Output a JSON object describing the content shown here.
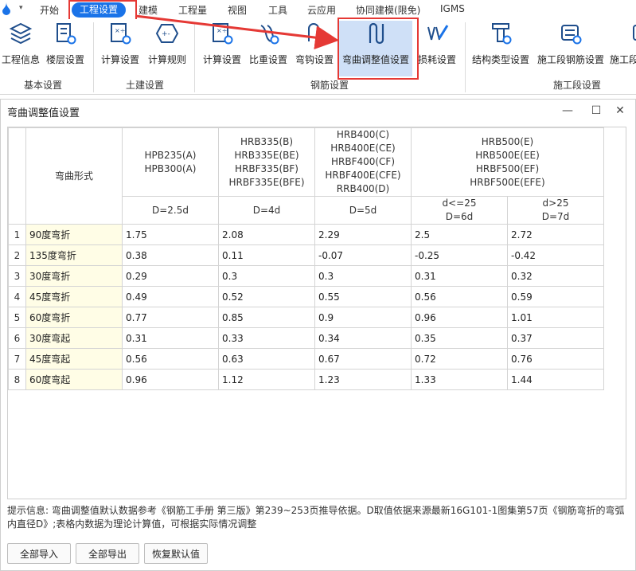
{
  "menubar": {
    "items": [
      "开始",
      "工程设置",
      "建模",
      "工程量",
      "视图",
      "工具",
      "云应用",
      "协同建模(限免)",
      "IGMS"
    ],
    "active_index": 1
  },
  "ribbon": {
    "groups": [
      {
        "label": "基本设置",
        "buttons": [
          {
            "label": "工程信息"
          },
          {
            "label": "楼层设置"
          }
        ]
      },
      {
        "label": "土建设置",
        "buttons": [
          {
            "label": "计算设置"
          },
          {
            "label": "计算规则"
          }
        ]
      },
      {
        "label": "钢筋设置",
        "buttons": [
          {
            "label": "计算设置"
          },
          {
            "label": "比重设置"
          },
          {
            "label": "弯钩设置"
          },
          {
            "label": "弯曲调整值设置"
          },
          {
            "label": "损耗设置"
          }
        ]
      },
      {
        "label": "施工段设置",
        "buttons": [
          {
            "label": "结构类型设置"
          },
          {
            "label": "施工段钢筋设置"
          },
          {
            "label": "施工段"
          }
        ]
      }
    ],
    "selected": "弯曲调整值设置"
  },
  "dialog": {
    "title": "弯曲调整值设置",
    "table": {
      "corner_header": "弯曲形式",
      "column_groups": [
        {
          "grades": "HPB235(A)\nHPB300(A)",
          "d_value": "D=2.5d"
        },
        {
          "grades": "HRB335(B)\nHRB335E(BE)\nHRBF335(BF)\nHRBF335E(BFE)",
          "d_value": "D=4d"
        },
        {
          "grades": "HRB400(C)\nHRB400E(CE)\nHRBF400(CF)\nHRBF400E(CFE)\nRRB400(D)",
          "d_value": "D=5d"
        },
        {
          "grades": "HRB500(E)\nHRB500E(EE)\nHRBF500(EF)\nHRBF500E(EFE)",
          "sub": [
            {
              "cond": "d<=25",
              "d_value": "D=6d"
            },
            {
              "cond": "d>25",
              "d_value": "D=7d"
            }
          ]
        }
      ],
      "rows": [
        {
          "no": "1",
          "shape": "90度弯折",
          "values": [
            "1.75",
            "2.08",
            "2.29",
            "2.5",
            "2.72"
          ]
        },
        {
          "no": "2",
          "shape": "135度弯折",
          "values": [
            "0.38",
            "0.11",
            "-0.07",
            "-0.25",
            "-0.42"
          ]
        },
        {
          "no": "3",
          "shape": "30度弯折",
          "values": [
            "0.29",
            "0.3",
            "0.3",
            "0.31",
            "0.32"
          ]
        },
        {
          "no": "4",
          "shape": "45度弯折",
          "values": [
            "0.49",
            "0.52",
            "0.55",
            "0.56",
            "0.59"
          ]
        },
        {
          "no": "5",
          "shape": "60度弯折",
          "values": [
            "0.77",
            "0.85",
            "0.9",
            "0.96",
            "1.01"
          ]
        },
        {
          "no": "6",
          "shape": "30度弯起",
          "values": [
            "0.31",
            "0.33",
            "0.34",
            "0.35",
            "0.37"
          ]
        },
        {
          "no": "7",
          "shape": "45度弯起",
          "values": [
            "0.56",
            "0.63",
            "0.67",
            "0.72",
            "0.76"
          ]
        },
        {
          "no": "8",
          "shape": "60度弯起",
          "values": [
            "0.96",
            "1.12",
            "1.23",
            "1.33",
            "1.44"
          ]
        }
      ]
    },
    "hint": "提示信息: 弯曲调整值默认数据参考《钢筋工手册 第三版》第239~253页推导依据。D取值依据来源最新16G101-1图集第57页《钢筋弯折的弯弧内直径D》;表格内数据为理论计算值，可根据实际情况调整",
    "buttons": {
      "import_all": "全部导入",
      "export_all": "全部导出",
      "restore_default": "恢复默认值"
    }
  },
  "colors": {
    "accent": "#1a73e8",
    "highlight": "#e53935",
    "shape_cell_bg": "#fffde6",
    "selected_ribbon_bg": "#cfe0f7"
  }
}
